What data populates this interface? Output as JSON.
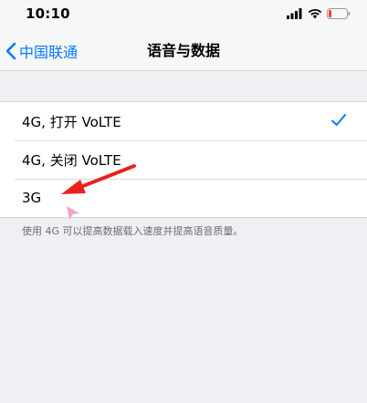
{
  "status_bar": {
    "time": "10:10",
    "icons": [
      "signal-icon",
      "wifi-icon",
      "battery-icon"
    ]
  },
  "nav": {
    "back_label": "中国联通",
    "title": "语音与数据"
  },
  "options": [
    {
      "label": "4G, 打开 VoLTE",
      "selected": true
    },
    {
      "label": "4G, 关闭 VoLTE",
      "selected": false
    },
    {
      "label": "3G",
      "selected": false
    }
  ],
  "footer_note": "使用 4G 可以提高数据载入速度并提高语音质量。",
  "colors": {
    "accent": "#007aff",
    "annotation_arrow": "#e8231e",
    "cursor": "#f4a6c4",
    "background": "#efeff4"
  }
}
